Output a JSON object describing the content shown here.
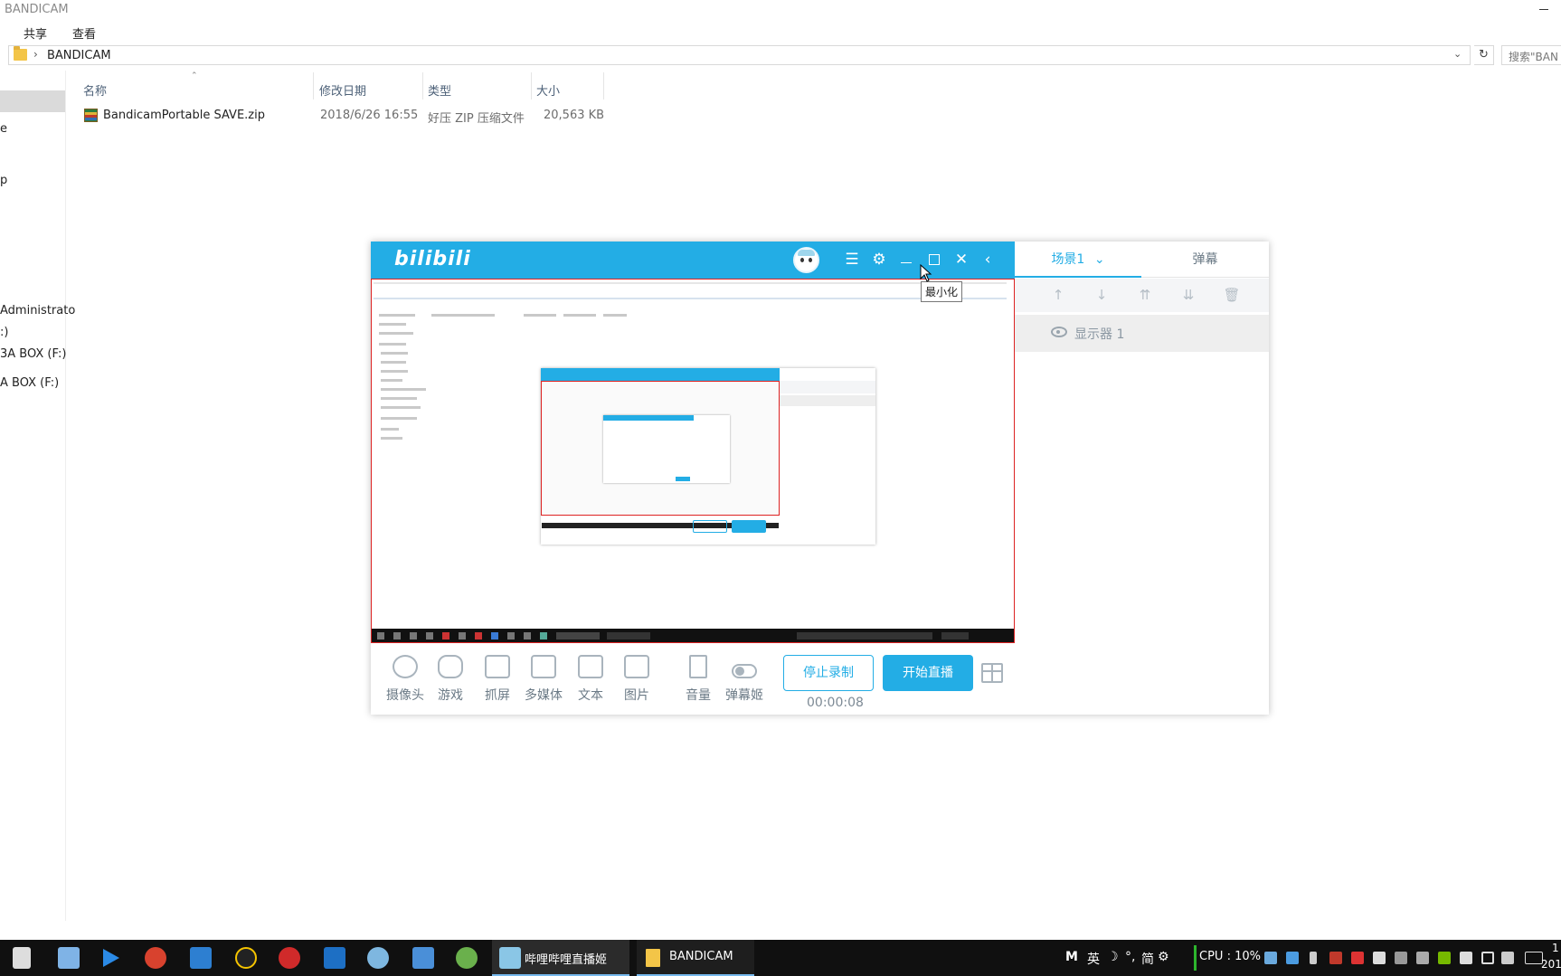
{
  "explorer": {
    "title": "BANDICAM",
    "ribbon_tabs": {
      "share": "共享",
      "view": "查看"
    },
    "address": {
      "separator": "›",
      "path": "BANDICAM",
      "refresh": "↻",
      "dropdown": "⌄"
    },
    "search_placeholder": "搜索\"BAN",
    "nav_items": [
      {
        "label": "e"
      },
      {
        "label": "p"
      },
      {
        "label": "Administrato"
      },
      {
        "label": ":)"
      },
      {
        "label": "3A BOX (F:)"
      },
      {
        "label": "A BOX (F:)"
      }
    ],
    "columns": {
      "name": "名称",
      "modified": "修改日期",
      "type": "类型",
      "size": "大小"
    },
    "files": [
      {
        "name": "BandicamPortable SAVE.zip",
        "modified": "2018/6/26 16:55",
        "type": "好压 ZIP 压缩文件",
        "size": "20,563 KB"
      }
    ]
  },
  "bili": {
    "logo": "bilibili",
    "header_icons": [
      "avatar",
      "menu-icon",
      "settings-icon",
      "minimize-icon",
      "maximize-icon",
      "close-icon",
      "collapse-icon"
    ],
    "tooltip": "最小化",
    "tools": [
      {
        "label": "摄像头",
        "icon": "camera-icon"
      },
      {
        "label": "游戏",
        "icon": "gamepad-icon"
      },
      {
        "label": "抓屏",
        "icon": "screen-capture-icon"
      },
      {
        "label": "多媒体",
        "icon": "media-folder-icon"
      },
      {
        "label": "文本",
        "icon": "text-icon"
      },
      {
        "label": "图片",
        "icon": "image-icon"
      },
      {
        "label": "音量",
        "icon": "volume-icon"
      },
      {
        "label": "弹幕姬",
        "icon": "toggle-icon"
      }
    ],
    "stop_record": "停止录制",
    "start_live": "开始直播",
    "timer": "00:00:08",
    "panel": {
      "scene_tab": "场景1",
      "danmaku_tab": "弹幕",
      "scene_item": "显示器 1",
      "panel_tools": [
        "↑",
        "↓",
        "⇈",
        "⇊",
        "🗑"
      ]
    }
  },
  "taskbar": {
    "apps": [
      {
        "label": "哔哩哔哩直播姬"
      },
      {
        "label": "BANDICAM"
      }
    ],
    "tray": {
      "ime_m": "M",
      "ime_lang": "英",
      "ime_moon": "☽",
      "ime_punct": "°,",
      "ime_simp": "简",
      "ime_gear": "⚙",
      "cpu": "CPU : 10%",
      "clock_top": "1",
      "clock_bottom": "201"
    },
    "colors": {
      "accent": "#23ade5",
      "taskbar": "#101010",
      "taskbar_active_border": "#76b9ed"
    }
  }
}
